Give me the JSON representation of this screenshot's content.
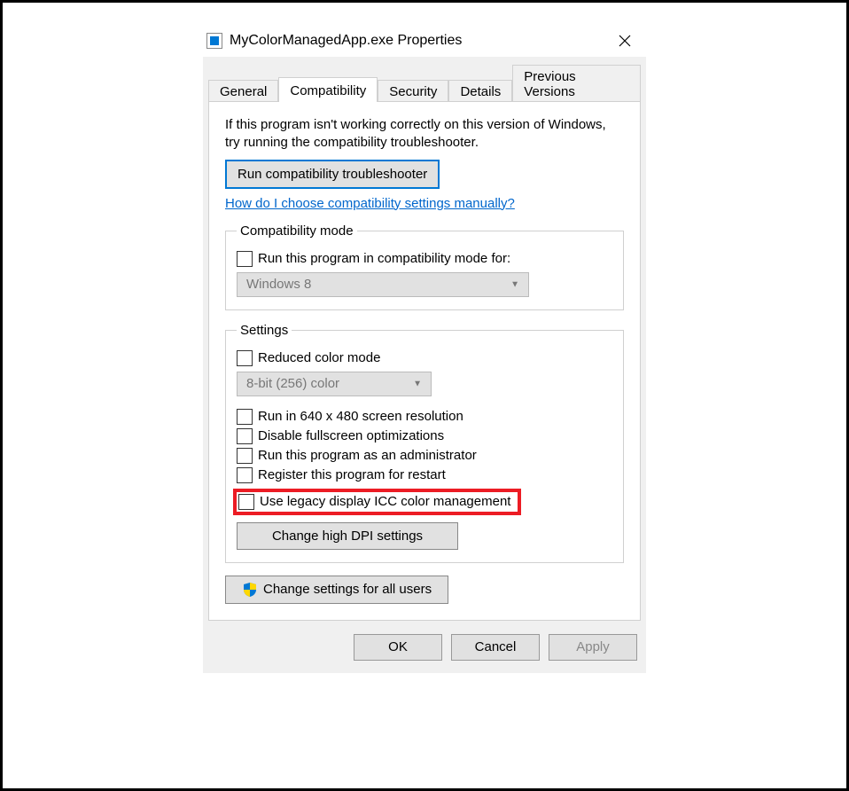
{
  "window": {
    "title": "MyColorManagedApp.exe Properties"
  },
  "tabs": {
    "general": "General",
    "compatibility": "Compatibility",
    "security": "Security",
    "details": "Details",
    "previous": "Previous Versions"
  },
  "intro": "If this program isn't working correctly on this version of Windows, try running the compatibility troubleshooter.",
  "buttons": {
    "troubleshoot": "Run compatibility troubleshooter",
    "help_link": "How do I choose compatibility settings manually?",
    "dpi": "Change high DPI settings",
    "all_users": "Change settings for all users",
    "ok": "OK",
    "cancel": "Cancel",
    "apply": "Apply"
  },
  "compat_mode": {
    "legend": "Compatibility mode",
    "checkbox": "Run this program in compatibility mode for:",
    "combo": "Windows 8"
  },
  "settings": {
    "legend": "Settings",
    "reduced_color": "Reduced color mode",
    "color_combo": "8-bit (256) color",
    "run_640": "Run in 640 x 480 screen resolution",
    "disable_fs": "Disable fullscreen optimizations",
    "run_admin": "Run this program as an administrator",
    "register_restart": "Register this program for restart",
    "legacy_icc": "Use legacy display ICC color management"
  }
}
